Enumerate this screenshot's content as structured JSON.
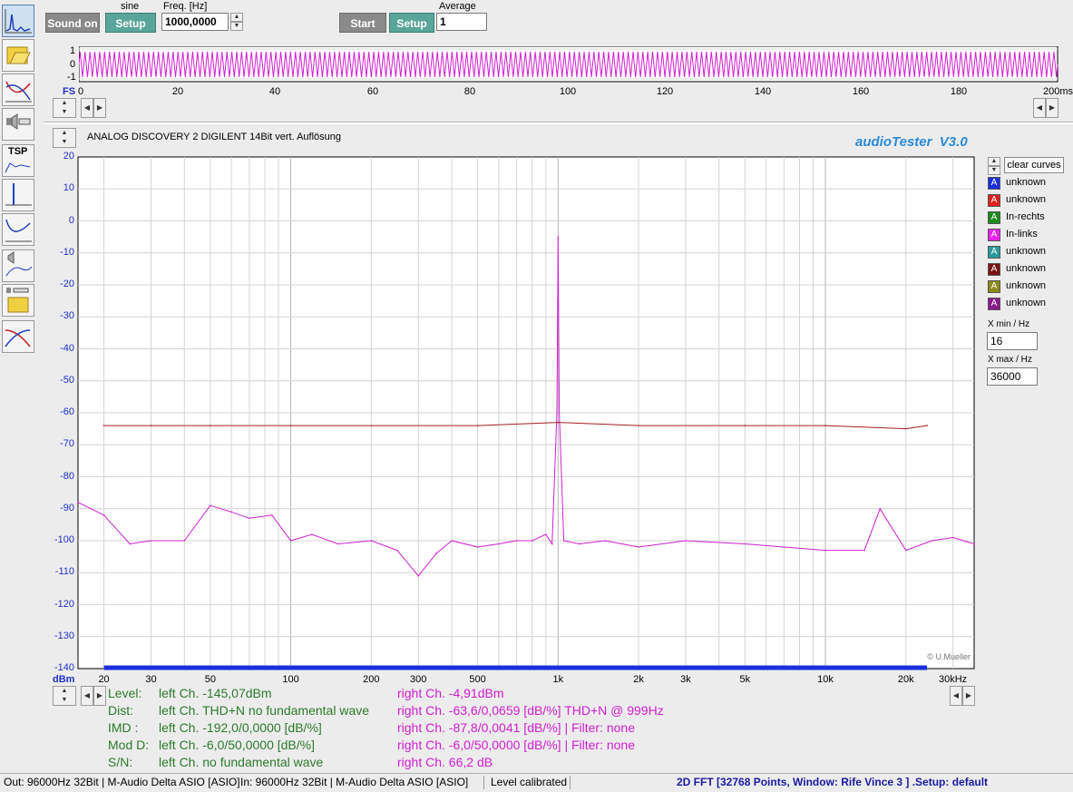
{
  "toolbar": {
    "sound_on": "Sound on",
    "signal_type": "sine",
    "setup1": "Setup",
    "freq_label": "Freq. [Hz]",
    "freq_value": "1000,0000",
    "start": "Start",
    "setup2": "Setup",
    "average_label": "Average",
    "average_value": "1"
  },
  "scope": {
    "y_ticks": [
      "1",
      "0",
      "-1"
    ],
    "fs_label": "FS",
    "x_ticks": [
      "0",
      "20",
      "40",
      "60",
      "80",
      "100",
      "120",
      "140",
      "160",
      "180"
    ],
    "x_end": "200ms"
  },
  "analyzer": {
    "device": "ANALOG DISCOVERY 2 DIGILENT 14Bit vert. Auflösung",
    "brand": "audioTester  V3.0",
    "copyright": "© U.Mueller",
    "y_unit": "dBm",
    "y_ticks": [
      "20",
      "10",
      "0",
      "-10",
      "-20",
      "-30",
      "-40",
      "-50",
      "-60",
      "-70",
      "-80",
      "-90",
      "-100",
      "-110",
      "-120",
      "-130",
      "-140"
    ],
    "x_ticks": [
      "20",
      "30",
      "50",
      "100",
      "200",
      "300",
      "500",
      "1k",
      "2k",
      "3k",
      "5k",
      "10k",
      "20k"
    ],
    "x_unit_label": "30kHz"
  },
  "legend": {
    "clear_curves": "clear curves",
    "items": [
      {
        "letter": "A",
        "label": "unknown",
        "color": "#1a2ee0"
      },
      {
        "letter": "A",
        "label": "unknown",
        "color": "#e02020"
      },
      {
        "letter": "A",
        "label": "In-rechts",
        "color": "#1a8a1a"
      },
      {
        "letter": "A",
        "label": "In-links",
        "color": "#f020f0"
      },
      {
        "letter": "A",
        "label": "unknown",
        "color": "#2a9a9a"
      },
      {
        "letter": "A",
        "label": "unknown",
        "color": "#7a1515"
      },
      {
        "letter": "A",
        "label": "unknown",
        "color": "#8a8a1a"
      },
      {
        "letter": "A",
        "label": "unknown",
        "color": "#8a1a8a"
      }
    ],
    "xmin_label": "X min / Hz",
    "xmin_value": "16",
    "xmax_label": "X max / Hz",
    "xmax_value": "36000"
  },
  "results": {
    "level_label": "Level:",
    "level_left": "left Ch. -145,07dBm",
    "level_right": "right Ch. -4,91dBm",
    "dist_label": "Dist:",
    "dist_left": "left Ch. THD+N  no fundamental wave",
    "dist_right": "right Ch. -63,6/0,0659 [dB/%] THD+N  @ 999Hz",
    "imd_label": "IMD  :",
    "imd_left": "left Ch. -192,0/0,0000 [dB/%]",
    "imd_right": "right Ch. -87,8/0,0041 [dB/%] |   Filter: none",
    "mod_label": "Mod D:",
    "mod_left": "left Ch. -6,0/50,0000 [dB/%]",
    "mod_right": "right Ch. -6,0/50,0000 [dB/%] |   Filter: none",
    "sn_label": "S/N:",
    "sn_left": "left Ch.  no fundamental wave",
    "sn_right": "right Ch. 66,2 dB"
  },
  "status": {
    "out": "Out: 96000Hz 32Bit  | M-Audio Delta ASIO [ASIO]",
    "in": "In: 96000Hz 32Bit  | M-Audio Delta ASIO [ASIO]",
    "cal": "Level calibrated",
    "fft": "2D FFT [32768 Points, Window: Rife Vince 3 ]  .Setup:  default"
  },
  "colors": {
    "magenta_trace": "#d020d0",
    "red_trace": "#a02020",
    "accent_blue": "#1f30c8",
    "brand_blue": "#2a8ad8"
  },
  "chart_data": {
    "type": "line",
    "x_scale": "log",
    "xlim": [
      16,
      36000
    ],
    "ylim": [
      -140,
      20
    ],
    "ylabel": "dBm",
    "grid": true,
    "series": [
      {
        "name": "In-links",
        "color": "#d020d0",
        "x": [
          16,
          20,
          25,
          30,
          40,
          50,
          60,
          70,
          85,
          100,
          120,
          150,
          200,
          250,
          300,
          350,
          400,
          500,
          600,
          700,
          800,
          900,
          950,
          990,
          1000,
          1010,
          1050,
          1200,
          1500,
          2000,
          3000,
          5000,
          7000,
          10000,
          14000,
          16000,
          20000,
          25000,
          30000,
          36000
        ],
        "y": [
          -88,
          -92,
          -101,
          -100,
          -100,
          -89,
          -91,
          -93,
          -92,
          -100,
          -98,
          -101,
          -100,
          -103,
          -111,
          -104,
          -100,
          -102,
          -101,
          -100,
          -100,
          -98,
          -101,
          -60,
          -5,
          -60,
          -100,
          -101,
          -100,
          -102,
          -100,
          -101,
          -102,
          -103,
          -103,
          -90,
          -103,
          -100,
          -99,
          -101
        ]
      },
      {
        "name": "In-rechts",
        "color": "#a02020",
        "x": [
          20,
          30,
          50,
          100,
          200,
          500,
          1000,
          2000,
          5000,
          10000,
          20000,
          24000
        ],
        "y": [
          -64,
          -64,
          -64,
          -64,
          -64,
          -64,
          -63,
          -64,
          -64,
          -64,
          -65,
          -64
        ]
      }
    ]
  }
}
